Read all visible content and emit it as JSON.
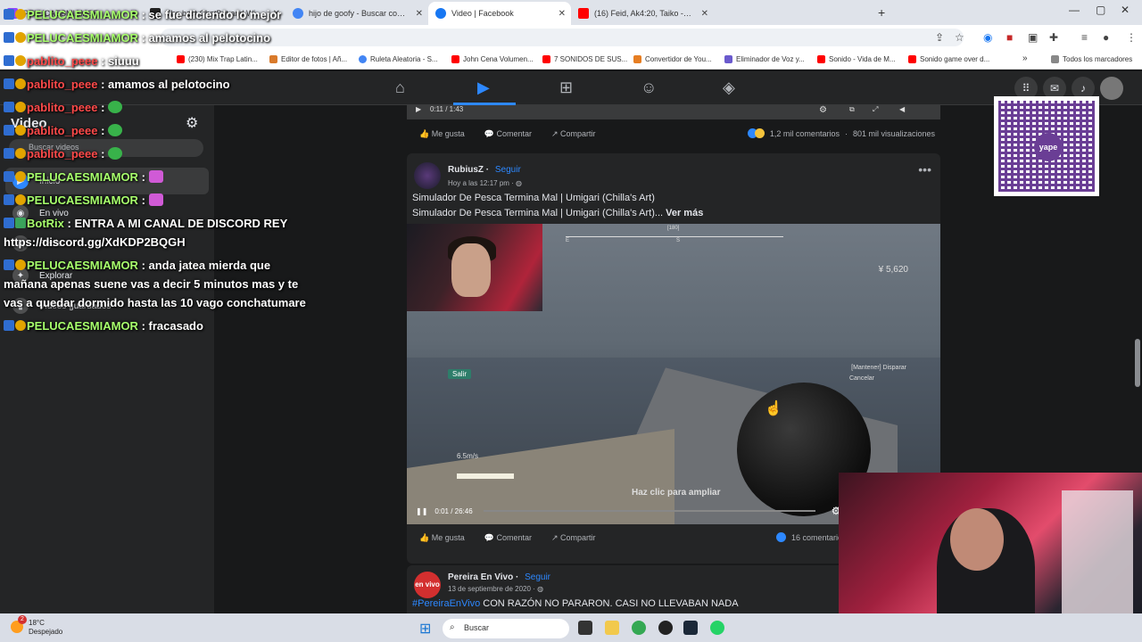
{
  "browser": {
    "tabs": [
      {
        "title": "PELUCAESMIAMOR",
        "color": "#9146ff"
      },
      {
        "title": "The best ChatBot and Widgets",
        "color": "#222222"
      },
      {
        "title": "hijo de goofy - Buscar con Goo",
        "color": "#4285f4"
      },
      {
        "title": "Video | Facebook",
        "color": "#1877f2",
        "active": true
      },
      {
        "title": "(16) Feid, Ak4:20, Taiko - Malibu",
        "color": "#ff0000"
      }
    ],
    "bookmarks": [
      {
        "label": "(230) Mix Trap Latin...",
        "color": "#ff0000"
      },
      {
        "label": "Editor de fotos | Añ...",
        "color": "#d97a2b"
      },
      {
        "label": "Ruleta Aleatoria - S...",
        "color": "#4285f4"
      },
      {
        "label": "John Cena Volumen...",
        "color": "#ff0000"
      },
      {
        "label": "7 SONIDOS DE SUS...",
        "color": "#ff0000"
      },
      {
        "label": "Convertidor de You...",
        "color": "#e67e22"
      },
      {
        "label": "Eliminador de Voz y...",
        "color": "#6a5acd"
      },
      {
        "label": "Sonido - Vida de M...",
        "color": "#ff0000"
      },
      {
        "label": "Sonido game over d...",
        "color": "#ff0000"
      }
    ],
    "bookmarks_all": "Todos los marcadores"
  },
  "facebook_sidebar": {
    "title": "Video",
    "search_placeholder": "Buscar videos",
    "items": [
      {
        "label": "Inicio",
        "icon": "home-icon"
      },
      {
        "label": "En vivo",
        "icon": "live-icon"
      },
      {
        "label": "Reels",
        "icon": "reels-icon"
      },
      {
        "label": "Explorar",
        "icon": "explore-icon"
      },
      {
        "label": "Videos guardados",
        "icon": "saved-icon"
      }
    ]
  },
  "feed": {
    "top_video": {
      "time": "0:11 / 1:43",
      "actions": {
        "like": "Me gusta",
        "comment": "Comentar",
        "share": "Compartir"
      },
      "comments": "1,2 mil comentarios",
      "views": "801 mil visualizaciones"
    },
    "post1": {
      "author": "RubiusZ",
      "follow": "Seguir",
      "meta": "Hoy a las 12:17 pm",
      "title": "Simulador De Pesca Termina Mal | Umigari (Chilla's Art)",
      "desc": "Simulador De Pesca Termina Mal | Umigari (Chilla's Art)...",
      "more": "Ver más",
      "game": {
        "compass_value": "180",
        "compass_e": "E",
        "compass_s": "S",
        "money": "¥ 5,620",
        "hint1": "[Mantener] Disparar",
        "hint2": "Cancelar",
        "exit": "Salir",
        "speed": "6.5m/s"
      },
      "zoom_hint": "Haz clic para ampliar",
      "time": "0:01 / 26:46",
      "progress": 0.0006,
      "actions": {
        "like": "Me gusta",
        "comment": "Comentar",
        "share": "Compartir"
      },
      "comments": "16 comentarios"
    },
    "post2": {
      "author": "Pereira En Vivo",
      "follow": "Seguir",
      "meta": "13 de septiembre de 2020",
      "avatar_text": "en vivo",
      "hashtag": "#PereiraEnVivo",
      "text": "CON RAZÓN NO PARARON. CASI NO LLEVABAN NADA"
    }
  },
  "chat": [
    {
      "user": "PELUCAESMIAMOR",
      "color": "green",
      "text": "se fue diciendo lo mejor",
      "overlay": true
    },
    {
      "user": "PELUCAESMIAMOR",
      "color": "green",
      "text": "amamos al pelotocino",
      "overlay": true
    },
    {
      "user": "pablito_peee",
      "color": "red",
      "text": "siuuu",
      "overlay": true
    },
    {
      "user": "pablito_peee",
      "color": "red",
      "text": "amamos al pelotocino"
    },
    {
      "user": "pablito_peee",
      "color": "red",
      "text": "",
      "emote": "green"
    },
    {
      "user": "pablito_peee",
      "color": "red",
      "text": "",
      "emote": "green"
    },
    {
      "user": "pablito_peee",
      "color": "red",
      "text": "",
      "emote": "green"
    },
    {
      "user": "PELUCAESMIAMOR",
      "color": "green",
      "text": "",
      "emote": "pink"
    },
    {
      "user": "PELUCAESMIAMOR",
      "color": "green",
      "text": "",
      "emote": "pink"
    },
    {
      "user": "BotRix",
      "color": "green",
      "text": "ENTRA A MI CANAL DE DISCORD REY https://discord.gg/XdKDP2BQGH"
    },
    {
      "user": "PELUCAESMIAMOR",
      "color": "green",
      "text": "anda jatea mierda que mañana apenas suene vas a decir 5 minutos mas y te vas a quedar dormido hasta las 10 vago conchatumare"
    },
    {
      "user": "PELUCAESMIAMOR",
      "color": "green",
      "text": "fracasado"
    }
  ],
  "qr": {
    "brand": "yape"
  },
  "taskbar": {
    "temp": "18°C",
    "weather": "Despejado",
    "notif_count": "2",
    "search": "Buscar"
  }
}
